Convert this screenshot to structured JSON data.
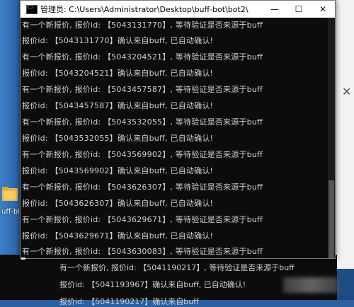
{
  "window": {
    "title": "管理员: C:\\Users\\Administrator\\Desktop\\buff-bot\\bot2\\",
    "minimize": "—",
    "maximize": "☐",
    "close": "✕"
  },
  "console_lines": [
    "有一个新报价, 报价id: 【5043131770】, 等待验证是否来源于buff",
    "报价id: 【5043131770】确认来自buff, 已自动确认!",
    "有一个新报价, 报价id: 【5043204521】, 等待验证是否来源于buff",
    "报价id: 【5043204521】确认来自buff, 已自动确认!",
    "有一个新报价, 报价id: 【5043457587】, 等待验证是否来源于buff",
    "报价id: 【5043457587】确认来自buff, 已自动确认!",
    "有一个新报价, 报价id: 【5043532055】, 等待验证是否来源于buff",
    "报价id: 【5043532055】确认来自buff, 已自动确认!",
    "有一个新报价, 报价id: 【5043569902】, 等待验证是否来源于buff",
    "报价id: 【5043569902】确认来自buff, 已自动确认!",
    "有一个新报价, 报价id: 【5043626307】, 等待验证是否来源于buff",
    "报价id: 【5043626307】确认来自buff, 已自动确认!",
    "有一个新报价, 报价id: 【5043629671】, 等待验证是否来源于buff",
    "报价id: 【5043629671】确认来自buff, 已自动确认!",
    "有一个新报价, 报价id: 【5043630083】, 等待验证是否来源于buff"
  ],
  "back_console_lines": [
    "有一个新报价, 报价id: 【5041190217】, 等待验证是否来源于buff",
    "报价id: 【5041193967】确认来自buff, 已自动确认!",
    "报价id: 【5041190217】确认来自buff"
  ],
  "desktop": {
    "folder_label": "uff-bi",
    "right_window_close": "✕"
  },
  "colors": {
    "console_bg": "#0c0c0c",
    "console_text": "#cfcfcf",
    "titlebar_bg": "#ffffff"
  }
}
